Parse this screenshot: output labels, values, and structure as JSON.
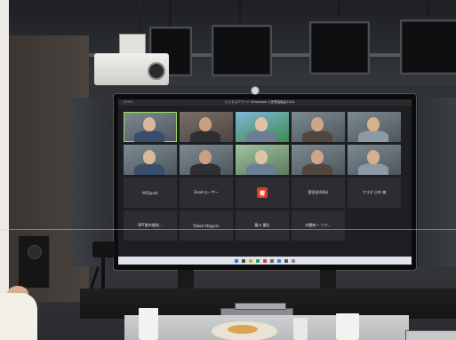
{
  "scene": {
    "window_title": "ビジネスアワード Wholesale 小売業協議会2024",
    "top_left_label": "ZOOM",
    "tiles": [
      {
        "type": "video",
        "name": ""
      },
      {
        "type": "video",
        "name": ""
      },
      {
        "type": "video",
        "name": ""
      },
      {
        "type": "video",
        "name": ""
      },
      {
        "type": "video",
        "name": ""
      },
      {
        "type": "video",
        "name": ""
      },
      {
        "type": "video",
        "name": ""
      },
      {
        "type": "video",
        "name": ""
      },
      {
        "type": "video",
        "name": ""
      },
      {
        "type": "video",
        "name": ""
      },
      {
        "type": "text",
        "center": "M32park",
        "name": ""
      },
      {
        "type": "text",
        "center": "Zoomユーザー",
        "name": ""
      },
      {
        "type": "badge",
        "center": "櫻",
        "name": ""
      },
      {
        "type": "text",
        "center": "菅田(JASNo)",
        "name": ""
      },
      {
        "type": "text",
        "center": "アゴタ 日中 僚",
        "name": ""
      },
      {
        "type": "text",
        "center": "BPT都市開発...",
        "name": ""
      },
      {
        "type": "text",
        "center": "Tobee Shipyrie",
        "name": ""
      },
      {
        "type": "text",
        "center": "藤川 壽比",
        "name": ""
      },
      {
        "type": "text",
        "center": "内閣府ー リウ...",
        "name": ""
      }
    ]
  },
  "colors": {
    "badge": "#e0392b",
    "active_speaker": "#9adf57",
    "taskbar": "#dfe3ea"
  }
}
